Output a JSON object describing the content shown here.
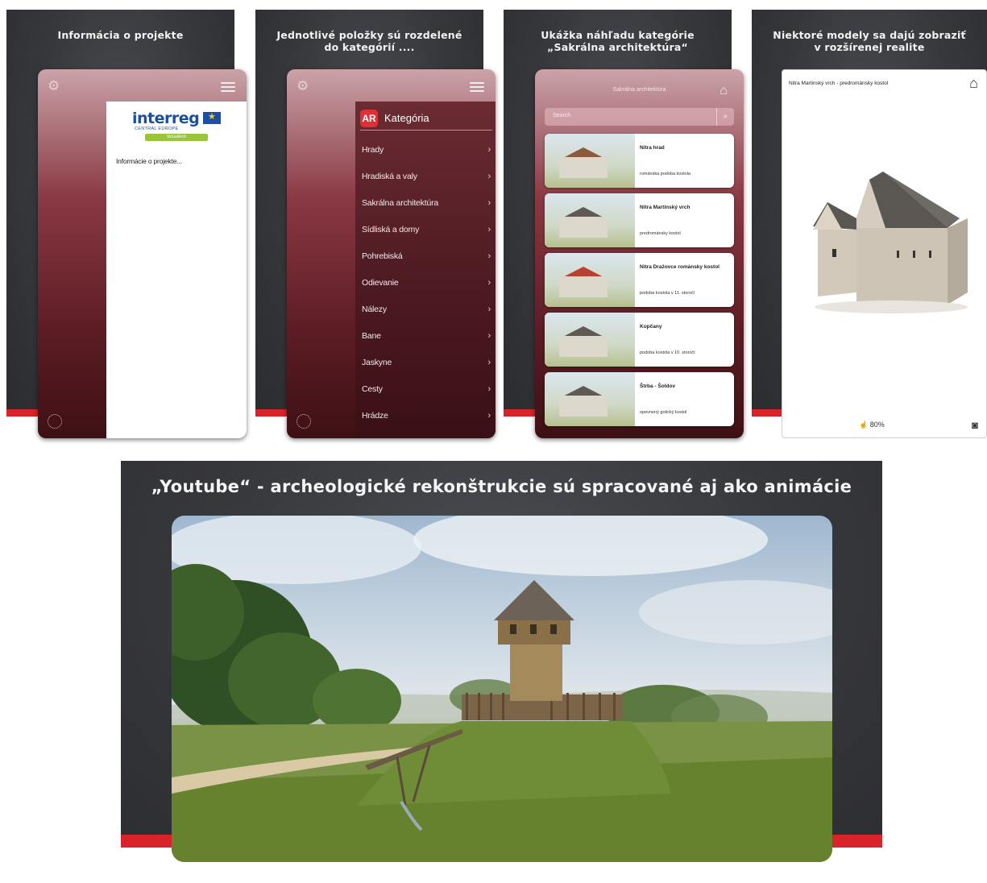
{
  "panels": [
    {
      "caption_line1": "Informácia o projekte",
      "caption_line2": ""
    },
    {
      "caption_line1": "Jednotlivé položky sú rozdelené",
      "caption_line2": "do kategórií ...."
    },
    {
      "caption_line1": "Ukážka náhľadu kategórie",
      "caption_line2": "„Sakrálna architektúra“"
    },
    {
      "caption_line1": "Niektoré modely sa dajú zobraziť",
      "caption_line2": "v rozšírenej realite"
    }
  ],
  "phone1": {
    "logo_word": "interreg",
    "logo_sub": "CENTRAL EUROPE",
    "logo_tag": "VirtualArch",
    "info_text": "Informácie o projekte..."
  },
  "phone2": {
    "menu_title": "Kategória",
    "categories": [
      "Hrady",
      "Hradiská a valy",
      "Sakrálna architektúra",
      "Sídliská a domy",
      "Pohrebiská",
      "Odievanie",
      "Nálezy",
      "Bane",
      "Jaskyne",
      "Cesty",
      "Hrádze"
    ]
  },
  "phone3": {
    "title": "Sakrálna architektúra",
    "search_placeholder": "Search",
    "cards": [
      {
        "title": "Nitra hrad",
        "subtitle": "románska podoba kostola"
      },
      {
        "title": "Nitra Martinský vrch",
        "subtitle": "predrománsky kostol"
      },
      {
        "title": "Nitra Dražovce románsky kostol",
        "subtitle": "podoba kostola v 11. storočí"
      },
      {
        "title": "Kopčany",
        "subtitle": "podoba kostola v 10. storočí"
      },
      {
        "title": "Štrba - Šoldov",
        "subtitle": "opevnený gotický kostol"
      }
    ]
  },
  "phone4": {
    "title": "Nitra Martinský vrch - predrománsky kostol",
    "zoom": "80%"
  },
  "video": {
    "caption": "„Youtube“ - archeologické rekonštrukcie sú spracované aj ako animácie"
  },
  "colors": {
    "accent_red": "#d9232a",
    "panel_dark": "#35373b",
    "burgundy": "#5e1d25"
  }
}
